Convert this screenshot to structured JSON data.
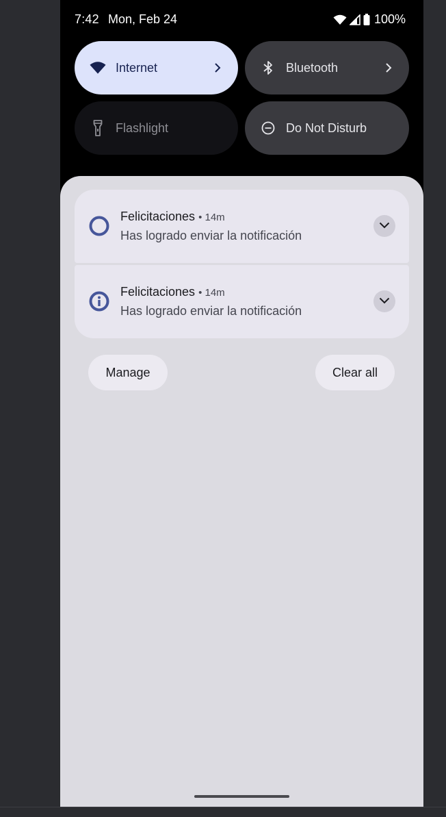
{
  "status_bar": {
    "time": "7:42",
    "date": "Mon, Feb 24",
    "battery_percent": "100%",
    "icons": [
      "wifi-icon",
      "cell-signal-icon",
      "battery-icon"
    ]
  },
  "quick_settings": {
    "tiles": [
      {
        "label": "Internet",
        "icon": "wifi-icon",
        "state": "on"
      },
      {
        "label": "Bluetooth",
        "icon": "bluetooth-icon",
        "state": "off"
      },
      {
        "label": "Flashlight",
        "icon": "flashlight-icon",
        "state": "unavailable"
      },
      {
        "label": "Do Not Disturb",
        "icon": "dnd-icon",
        "state": "off"
      }
    ]
  },
  "notifications": [
    {
      "app": "Felicitaciones",
      "time": "14m",
      "text": "Has logrado enviar la notificación",
      "icon": "ring-icon"
    },
    {
      "app": "Felicitaciones",
      "time": "14m",
      "text": "Has logrado enviar la notificación",
      "icon": "info-icon"
    }
  ],
  "actions": {
    "manage_label": "Manage",
    "clear_all_label": "Clear all"
  },
  "colors": {
    "accent": "#46569a",
    "tile_active_bg": "#dde3fb",
    "tile_inactive_bg": "#3a3a3f",
    "shade_bg": "#dcdbe1",
    "card_bg": "#e8e6ef"
  }
}
